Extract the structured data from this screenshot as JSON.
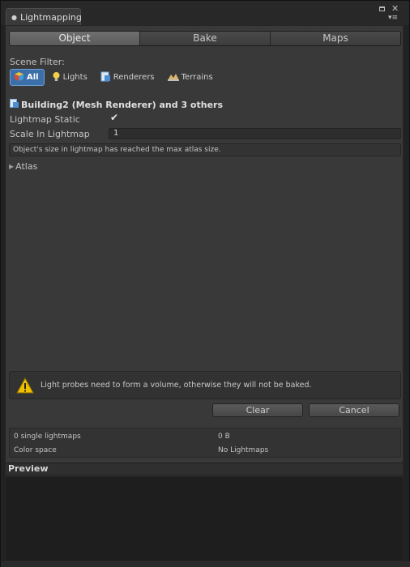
{
  "window": {
    "tab_title": "Lightmapping",
    "pin_icon": "pin-icon"
  },
  "tabs": [
    {
      "label": "Object",
      "active": true
    },
    {
      "label": "Bake",
      "active": false
    },
    {
      "label": "Maps",
      "active": false
    }
  ],
  "scene_filter": {
    "label": "Scene Filter:",
    "options": [
      {
        "label": "All",
        "icon": "cube-icon",
        "active": true
      },
      {
        "label": "Lights",
        "icon": "lightbulb-icon",
        "active": false
      },
      {
        "label": "Renderers",
        "icon": "renderer-icon",
        "active": false
      },
      {
        "label": "Terrains",
        "icon": "terrain-icon",
        "active": false
      }
    ]
  },
  "selection": {
    "title": "Building2 (Mesh Renderer) and 3 others",
    "icon": "mesh-renderer-icon"
  },
  "properties": {
    "lightmap_static_label": "Lightmap Static",
    "lightmap_static_checked": true,
    "scale_label": "Scale In Lightmap",
    "scale_value": "1",
    "info_text": "Object's size in lightmap has reached the max atlas size.",
    "atlas_label": "Atlas"
  },
  "warning": {
    "text": "Light probes need to form a volume, otherwise they will not be baked.",
    "icon": "warning-icon"
  },
  "buttons": {
    "clear": "Clear",
    "cancel": "Cancel"
  },
  "stats": {
    "lightmaps_label": "0 single lightmaps",
    "lightmaps_value": "0 B",
    "color_space_label": "Color space",
    "color_space_value": "No Lightmaps"
  },
  "preview": {
    "label": "Preview"
  },
  "colors": {
    "accent": "#3c6fa8",
    "warning": "#f0c000"
  }
}
